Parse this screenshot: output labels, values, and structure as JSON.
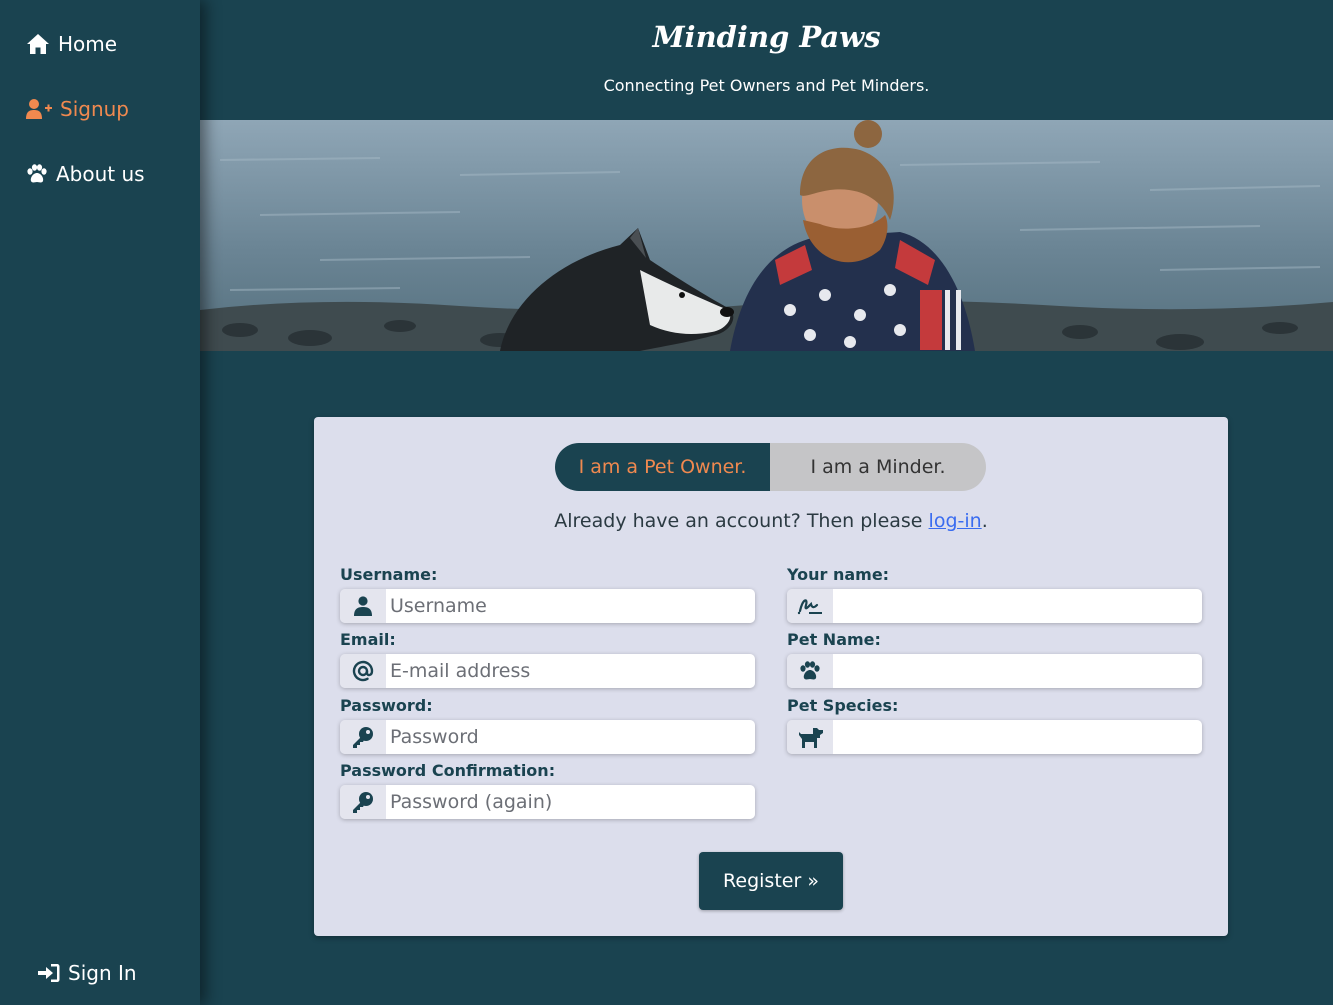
{
  "nav": {
    "home": "Home",
    "signup": "Signup",
    "about": "About us",
    "signin": "Sign In"
  },
  "header": {
    "title": "Minding Paws",
    "tagline": "Connecting Pet Owners and Pet Minders."
  },
  "hero": {
    "icon": "dog-and-man-photo"
  },
  "signup": {
    "toggle": {
      "owner": "I am a Pet Owner.",
      "minder": "I am a Minder.",
      "selected": "owner"
    },
    "login_prefix": "Already have an account? Then please ",
    "login_link": "log-in",
    "login_suffix": ".",
    "fields": {
      "username": {
        "label": "Username:",
        "placeholder": "Username",
        "icon": "user-icon"
      },
      "email": {
        "label": "Email:",
        "placeholder": "E-mail address",
        "icon": "at-icon"
      },
      "password": {
        "label": "Password:",
        "placeholder": "Password",
        "icon": "key-icon"
      },
      "password_confirm": {
        "label": "Password Confirmation:",
        "placeholder": "Password (again)",
        "icon": "key-icon"
      },
      "your_name": {
        "label": "Your name:",
        "placeholder": "",
        "icon": "signature-icon"
      },
      "pet_name": {
        "label": "Pet Name:",
        "placeholder": "",
        "icon": "paw-icon"
      },
      "pet_species": {
        "label": "Pet Species:",
        "placeholder": "",
        "icon": "dog-icon"
      }
    },
    "register_label": "Register »"
  },
  "colors": {
    "background": "#1a4350",
    "accent": "#f0894f",
    "card": "#dcdeec",
    "link": "#3a6cf0"
  }
}
